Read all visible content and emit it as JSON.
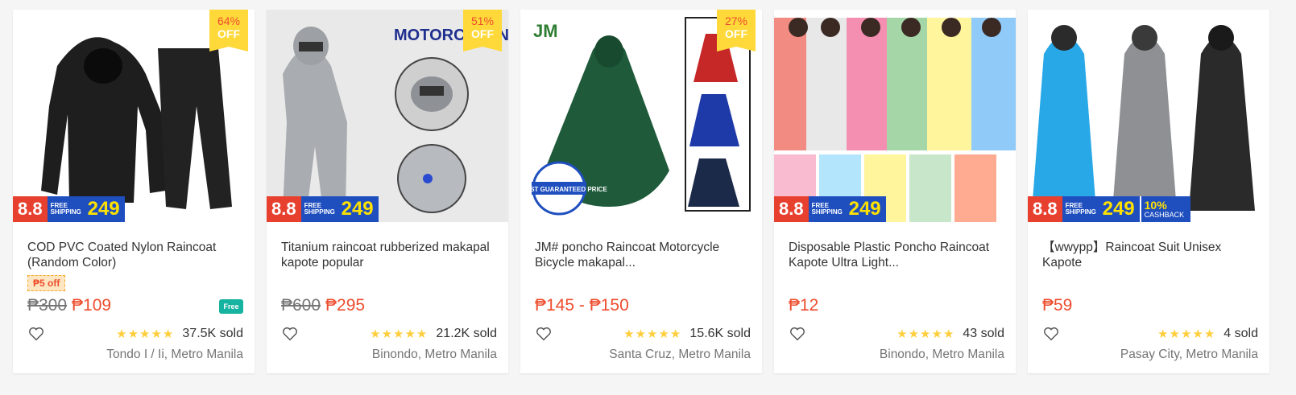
{
  "products": [
    {
      "discount_pct": "64%",
      "discount_off": "OFF",
      "promo": {
        "badge": "8.8",
        "ship_label": "FREE SHIPPING",
        "ship_amount": "249"
      },
      "title": "COD PVC Coated Nylon Raincoat (Random Color)",
      "voucher": "₱5 off",
      "original_price": "₱300",
      "price": "₱109",
      "free_ship_icon": "Free",
      "stars": "★★★★★",
      "sold": "37.5K sold",
      "location": "Tondo I / Ii, Metro Manila"
    },
    {
      "discount_pct": "51%",
      "discount_off": "OFF",
      "promo": {
        "badge": "8.8",
        "ship_label": "FREE SHIPPING",
        "ship_amount": "249"
      },
      "image_text": "MOTORC RAINC",
      "title": "Titanium raincoat rubberized makapal kapote popular",
      "original_price": "₱600",
      "price": "₱295",
      "stars": "★★★★★",
      "sold": "21.2K sold",
      "location": "Binondo, Metro Manila"
    },
    {
      "discount_pct": "27%",
      "discount_off": "OFF",
      "image_logo": "JM",
      "seal_text": "LOWEST GUARANTEED PRICE",
      "title": "JM# poncho Raincoat Motorcycle Bicycle makapal...",
      "price": "₱145 - ₱150",
      "stars": "★★★★★",
      "sold": "15.6K sold",
      "location": "Santa Cruz, Metro Manila"
    },
    {
      "promo": {
        "badge": "8.8",
        "ship_label": "FREE SHIPPING",
        "ship_amount": "249"
      },
      "title": "Disposable Plastic Poncho Raincoat Kapote Ultra Light...",
      "price": "₱12",
      "stars": "★★★★★",
      "sold": "43 sold",
      "location": "Binondo, Metro Manila"
    },
    {
      "promo": {
        "badge": "8.8",
        "ship_label": "FREE SHIPPING",
        "ship_amount": "249",
        "cashback_pct": "10%",
        "cashback_label": "CASHBACK"
      },
      "title": "【wwypp】Raincoat Suit Unisex Kapote",
      "price": "₱59",
      "stars": "★★★★★",
      "sold": "4 sold",
      "location": "Pasay City, Metro Manila"
    }
  ],
  "colors": {
    "accent": "#ee4d2d",
    "promo_blue": "#1f4fbf",
    "star": "#ffce3d",
    "tag_yellow": "#ffd839"
  },
  "icons": {
    "wishlist": "heart-outline-icon",
    "free_shipping": "truck-icon"
  }
}
